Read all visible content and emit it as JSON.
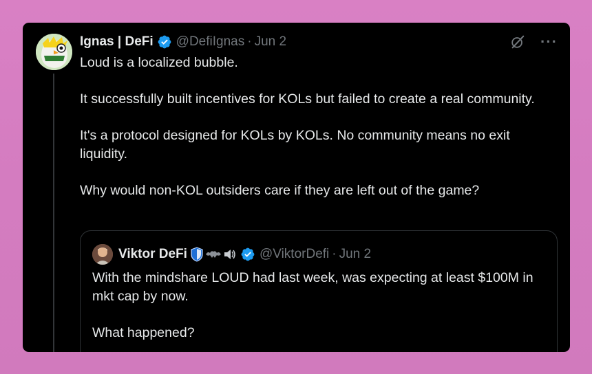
{
  "tweet": {
    "author_name": "Ignas | DeFi",
    "handle": "@DefiIgnas",
    "separator": "·",
    "date": "Jun 2",
    "more_label": "···",
    "paragraphs": [
      "Loud is a localized bubble.",
      "It successfully built incentives for KOLs but failed to create a real community.",
      "It's a protocol designed for KOLs by KOLs. No community means no exit liquidity.",
      "Why would non-KOL outsiders care if they are left out of the game?"
    ]
  },
  "quote": {
    "author_name": "Viktor DeFi",
    "name_emojis": "🛡🦇🔊",
    "handle": "@ViktorDefi",
    "separator": "·",
    "date": "Jun 2",
    "paragraphs": [
      "With the mindshare LOUD had last week, was expecting at least $100M in mkt cap by now.",
      "What happened?"
    ]
  },
  "colors": {
    "background": "#d47cc0",
    "card": "#000000",
    "text": "#e7e9ea",
    "muted": "#71767b",
    "verified": "#1d9bf0"
  },
  "icons": [
    "verified-badge-icon",
    "grok-icon",
    "more-icon"
  ]
}
